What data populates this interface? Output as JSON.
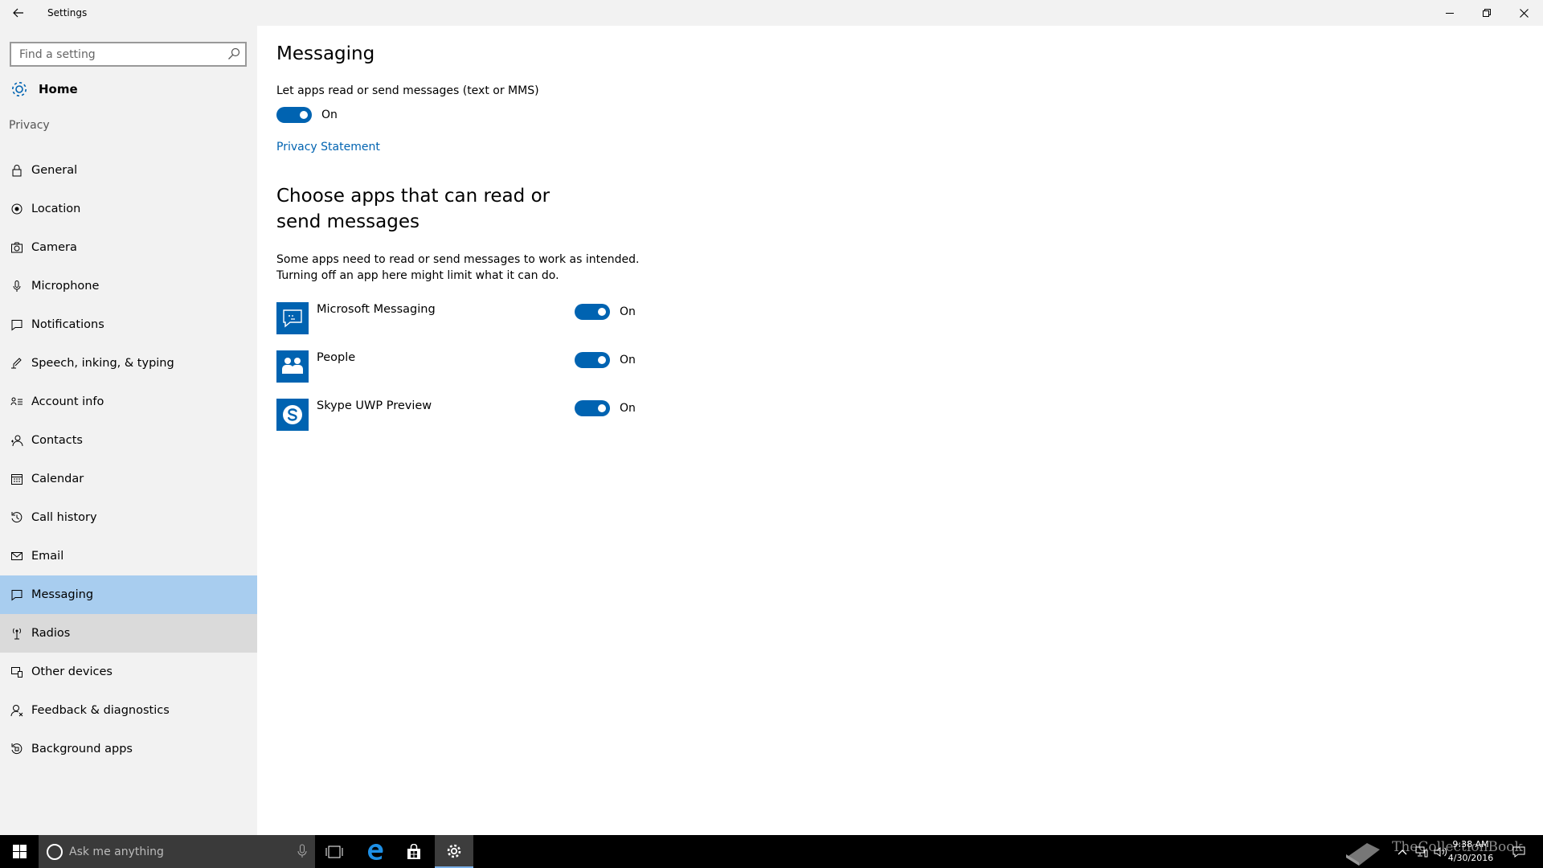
{
  "window": {
    "title": "Settings"
  },
  "sidebar": {
    "search_placeholder": "Find a setting",
    "home_label": "Home",
    "section_label": "Privacy",
    "items": [
      {
        "label": "General",
        "icon": "lock-icon"
      },
      {
        "label": "Location",
        "icon": "location-icon"
      },
      {
        "label": "Camera",
        "icon": "camera-icon"
      },
      {
        "label": "Microphone",
        "icon": "microphone-icon"
      },
      {
        "label": "Notifications",
        "icon": "notifications-icon"
      },
      {
        "label": "Speech, inking, & typing",
        "icon": "speech-icon"
      },
      {
        "label": "Account info",
        "icon": "account-info-icon"
      },
      {
        "label": "Contacts",
        "icon": "contacts-icon"
      },
      {
        "label": "Calendar",
        "icon": "calendar-icon"
      },
      {
        "label": "Call history",
        "icon": "history-icon"
      },
      {
        "label": "Email",
        "icon": "email-icon"
      },
      {
        "label": "Messaging",
        "icon": "messaging-icon",
        "selected": true
      },
      {
        "label": "Radios",
        "icon": "radios-icon"
      },
      {
        "label": "Other devices",
        "icon": "devices-icon"
      },
      {
        "label": "Feedback & diagnostics",
        "icon": "feedback-icon"
      },
      {
        "label": "Background apps",
        "icon": "background-apps-icon"
      }
    ]
  },
  "main": {
    "title": "Messaging",
    "master_description": "Let apps read or send messages (text or MMS)",
    "master_toggle_label": "On",
    "privacy_link": "Privacy Statement",
    "apps_heading": "Choose apps that can read or send messages",
    "apps_description": "Some apps need to read or send messages to work as intended. Turning off an app here might limit what it can do.",
    "apps": [
      {
        "name": "Microsoft Messaging",
        "state": "On",
        "icon": "messaging-app-icon"
      },
      {
        "name": "People",
        "state": "On",
        "icon": "people-app-icon"
      },
      {
        "name": "Skype UWP Preview",
        "state": "On",
        "icon": "skype-app-icon"
      }
    ]
  },
  "taskbar": {
    "search_placeholder": "Ask me anything",
    "time": "9:38 AM",
    "date": "4/30/2016",
    "watermark": "TheCollectionBook"
  },
  "colors": {
    "accent": "#0063b1",
    "selected_nav": "#a8cdef",
    "sidebar_bg": "#f2f2f2"
  }
}
